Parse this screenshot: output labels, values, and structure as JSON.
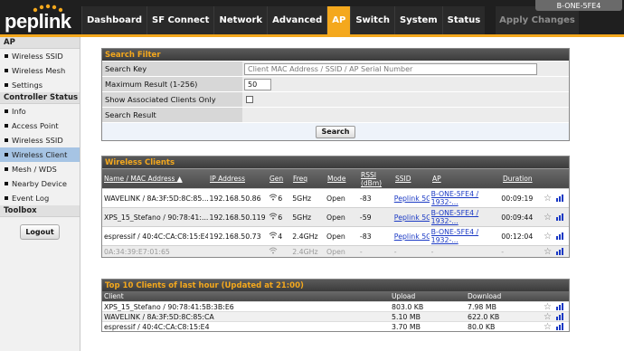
{
  "header": {
    "logo_text": "peplink",
    "device_name": "B-ONE-5FE4",
    "apply_label": "Apply Changes",
    "tabs": [
      "Dashboard",
      "SF Connect",
      "Network",
      "Advanced",
      "AP",
      "Switch",
      "System",
      "Status"
    ],
    "active_tab": "AP"
  },
  "sidebar": {
    "ap_title": "AP",
    "ap_items": [
      "Wireless SSID",
      "Wireless Mesh",
      "Settings"
    ],
    "controller_title": "Controller Status",
    "controller_items": [
      "Info",
      "Access Point",
      "Wireless SSID",
      "Wireless Client",
      "Mesh / WDS",
      "Nearby Device",
      "Event Log"
    ],
    "active_item": "Wireless Client",
    "toolbox_title": "Toolbox",
    "logout_label": "Logout"
  },
  "search_filter": {
    "title": "Search Filter",
    "search_key_label": "Search Key",
    "search_key_placeholder": "Client MAC Address / SSID / AP Serial Number",
    "max_result_label": "Maximum Result (1-256)",
    "max_result_value": "50",
    "assoc_label": "Show Associated Clients Only",
    "search_result_label": "Search Result",
    "search_button": "Search"
  },
  "wireless_clients": {
    "title": "Wireless Clients",
    "columns": [
      "Name / MAC Address ▲",
      "IP Address",
      "Gen",
      "Freq",
      "Mode",
      "RSSI (dBm)",
      "SSID",
      "AP",
      "Duration"
    ],
    "rows": [
      {
        "name": "WAVELINK / 8A:3F:5D:8C:85...",
        "ip": "192.168.50.86",
        "gen": "6",
        "freq": "5GHz",
        "mode": "Open",
        "rssi": "-83",
        "ssid": "Peplink 5G",
        "ap1": "B-ONE-5FE4 /",
        "ap2": "1932-...",
        "duration": "00:09:19"
      },
      {
        "name": "XPS_15_Stefano / 90:78:41:...",
        "ip": "192.168.50.119",
        "gen": "6",
        "freq": "5GHz",
        "mode": "Open",
        "rssi": "-59",
        "ssid": "Peplink 5G",
        "ap1": "B-ONE-5FE4 /",
        "ap2": "1932-...",
        "duration": "00:09:44"
      },
      {
        "name": "espressif / 40:4C:CA:C8:15:E4",
        "ip": "192.168.50.73",
        "gen": "4",
        "freq": "2.4GHz",
        "mode": "Open",
        "rssi": "-83",
        "ssid": "Peplink 5G",
        "ap1": "B-ONE-5FE4 /",
        "ap2": "1932-...",
        "duration": "00:12:04"
      }
    ],
    "inactive_row": {
      "name": "0A:34:39:E7:01:65",
      "gen": "",
      "freq": "2.4GHz",
      "mode": "Open",
      "rssi": "-",
      "ssid": "-",
      "ap": "-",
      "duration": "-"
    }
  },
  "top_clients": {
    "title": "Top 10 Clients of last hour (Updated at 21:00)",
    "columns": [
      "Client",
      "Upload",
      "Download"
    ],
    "rows": [
      {
        "client": "XPS_15_Stefano / 90:78:41:5B:3B:E6",
        "upload": "803.0 KB",
        "download": "7.98 MB"
      },
      {
        "client": "WAVELINK / 8A:3F:5D:8C:85:CA",
        "upload": "5.10 MB",
        "download": "622.0 KB"
      },
      {
        "client": "espressif / 40:4C:CA:C8:15:E4",
        "upload": "3.70 MB",
        "download": "80.0 KB"
      }
    ]
  },
  "colors": {
    "accent": "#f4a81d",
    "header_bg": "#1f1f1f",
    "link": "#1a39c4",
    "active_side": "#a6c4e4"
  },
  "icons": {
    "wifi": "wifi-signal-icon",
    "star": "star-icon",
    "chart": "bar-chart-icon",
    "sort": "sort-asc-icon"
  }
}
